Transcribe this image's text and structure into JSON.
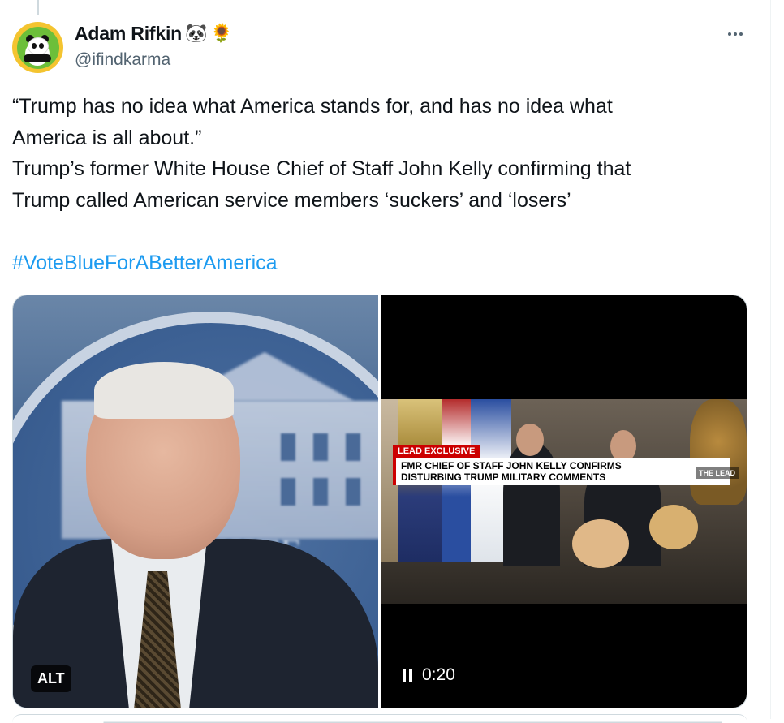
{
  "author": {
    "display_name": "Adam Rifkin",
    "emoji_1": "🐼",
    "emoji_2": "🌻",
    "handle": "@ifindkarma"
  },
  "tweet": {
    "lines": [
      "“Trump has no idea what America stands for, and has no idea what",
      "America is all about.”",
      "Trump’s former White House Chief of Staff John Kelly confirming that",
      "Trump called American service members ‘suckers’ and ‘losers’"
    ],
    "hashtag": "#VoteBlueForABetterAmerica"
  },
  "media": {
    "photo": {
      "alt_badge": "ALT",
      "background_sign_text": "HITE HOU"
    },
    "video": {
      "lower_third_tag": "LEAD EXCLUSIVE",
      "lower_third_line_1": "FMR CHIEF OF STAFF JOHN KELLY CONFIRMS",
      "lower_third_line_2": "DISTURBING TRUMP MILITARY COMMENTS",
      "network_bug": "THE LEAD",
      "time": "0:20"
    }
  },
  "colors": {
    "text_primary": "#0f1419",
    "text_secondary": "#536471",
    "link": "#1d9bf0",
    "border": "#cfd9de"
  },
  "icons": {
    "more": "more-horizontal-icon",
    "pause": "pause-icon"
  }
}
